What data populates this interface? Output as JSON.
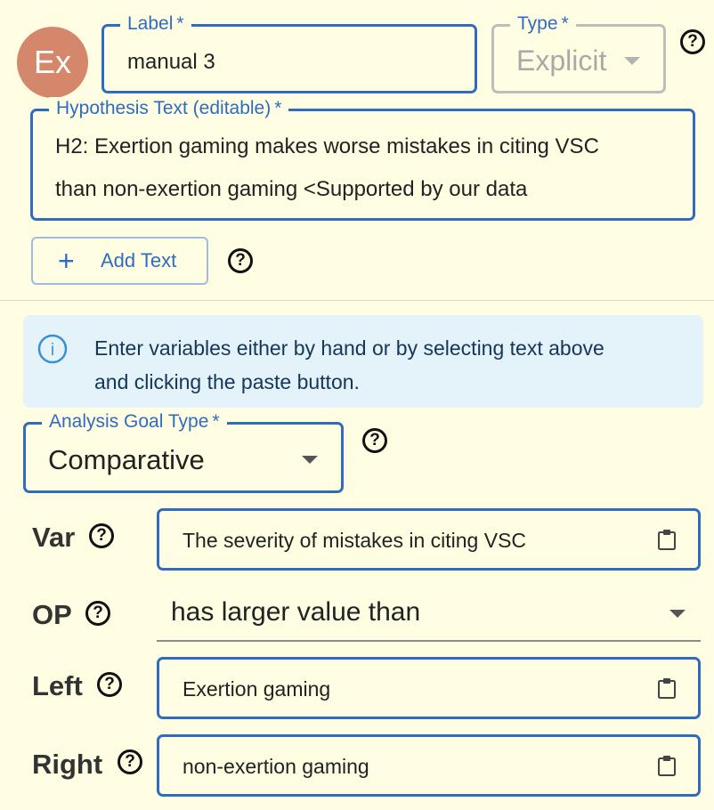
{
  "avatar": {
    "text": "Ex"
  },
  "label_field": {
    "legend": "Label",
    "required": "*",
    "value": "manual 3"
  },
  "type_field": {
    "legend": "Type",
    "required": "*",
    "value": "Explicit"
  },
  "hypothesis_field": {
    "legend": "Hypothesis Text (editable)",
    "required": "*",
    "line1": "H2: Exertion gaming makes worse mistakes in citing VSC",
    "line2": "than non-exertion gaming <Supported by our data"
  },
  "add_text_button": {
    "icon": "+",
    "label": "Add Text"
  },
  "help_glyph": "?",
  "info": {
    "icon_glyph": "i",
    "line1": "Enter variables either by hand or by selecting text above",
    "line2": "and clicking the paste button."
  },
  "analysis_goal": {
    "legend": "Analysis Goal Type",
    "required": "*",
    "value": "Comparative"
  },
  "rows": {
    "var": {
      "label": "Var",
      "value": "The severity of mistakes in citing VSC"
    },
    "op": {
      "label": "OP",
      "value": "has larger value than"
    },
    "left": {
      "label": "Left",
      "value": "Exertion gaming"
    },
    "right": {
      "label": "Right",
      "value": "non-exertion gaming"
    }
  },
  "colors": {
    "accent": "#2f6bbf",
    "background": "#fffee3",
    "avatar": "#d4876a",
    "info_bg": "#e4f2fa"
  }
}
